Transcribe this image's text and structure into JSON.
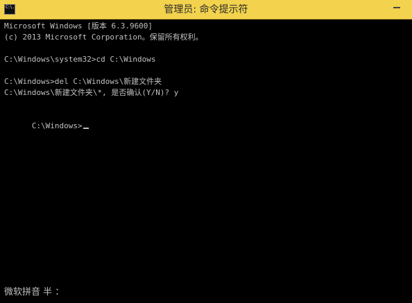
{
  "window": {
    "title": "管理员: 命令提示符",
    "icon": "cmd-icon",
    "icon_text": "C:\\."
  },
  "console": {
    "lines": [
      "Microsoft Windows [版本 6.3.9600]",
      "(c) 2013 Microsoft Corporation。保留所有权利。",
      "",
      "C:\\Windows\\system32>cd C:\\Windows",
      "",
      "C:\\Windows>del C:\\Windows\\新建文件夹",
      "C:\\Windows\\新建文件夹\\*, 是否确认(Y/N)? y",
      "",
      "C:\\Windows>"
    ],
    "prompt": "C:\\Windows>"
  },
  "ime": {
    "status": "微软拼音 半 ："
  }
}
